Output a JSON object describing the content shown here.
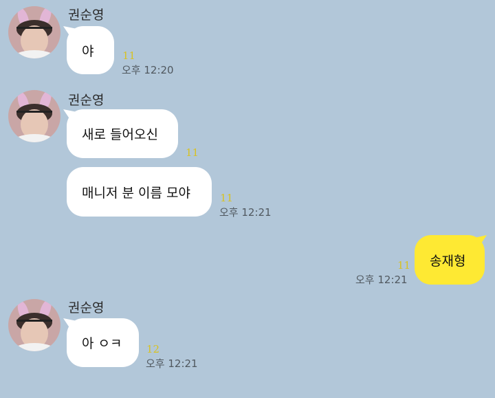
{
  "chat": {
    "groups": [
      {
        "sender": "권순영",
        "messages": [
          {
            "text": "야",
            "unread": "11",
            "time": "오후 12:20"
          }
        ]
      },
      {
        "sender": "권순영",
        "messages": [
          {
            "text": "새로 들어오신",
            "unread": "11"
          },
          {
            "text": "매니저 분 이름 모야",
            "unread": "11",
            "time": "오후 12:21"
          }
        ]
      },
      {
        "sender": "me",
        "messages": [
          {
            "text": "송재형",
            "unread": "11",
            "time": "오후 12:21"
          }
        ]
      },
      {
        "sender": "권순영",
        "messages": [
          {
            "text": "아 ㅇㅋ",
            "unread": "12",
            "time": "오후 12:21"
          }
        ]
      }
    ]
  },
  "colors": {
    "background": "#b2c7d9",
    "incoming_bubble": "#ffffff",
    "outgoing_bubble": "#fee933",
    "unread_count": "#d8c221",
    "timestamp": "#50585f"
  },
  "icons": {
    "avatar": "profile-photo-bunny-ears"
  }
}
